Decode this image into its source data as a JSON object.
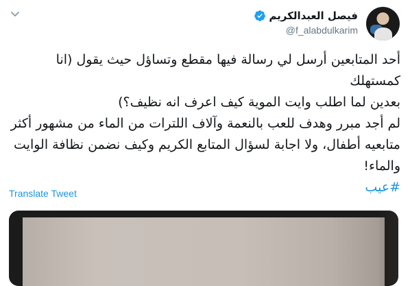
{
  "user": {
    "display_name": "فيصل العبدالكريم",
    "handle": "@f_alabdulkarim",
    "verified_icon": "verified-badge-icon"
  },
  "tweet": {
    "line1": "أحد المتابعين أرسل لي رسالة فيها مقطع وتساؤل حيث يقول (انا كمستهلك",
    "line2": "بعدين لما اطلب وايت الموية كيف اعرف انه نظيف؟)",
    "line3": "لم أجد مبرر وهدف للعب بالنعمة وآلاف اللترات من الماء من مشهور أكثر",
    "line4": "متابعيه أطفال، ولا اجابة لسؤال المتابع الكريم وكيف نضمن نظافة الوايت",
    "line5": "والماء!",
    "hashtag": "#عيب"
  },
  "translate_label": "Translate Tweet",
  "colors": {
    "accent": "#1b95e0",
    "text": "#14171a",
    "muted": "#657786"
  }
}
